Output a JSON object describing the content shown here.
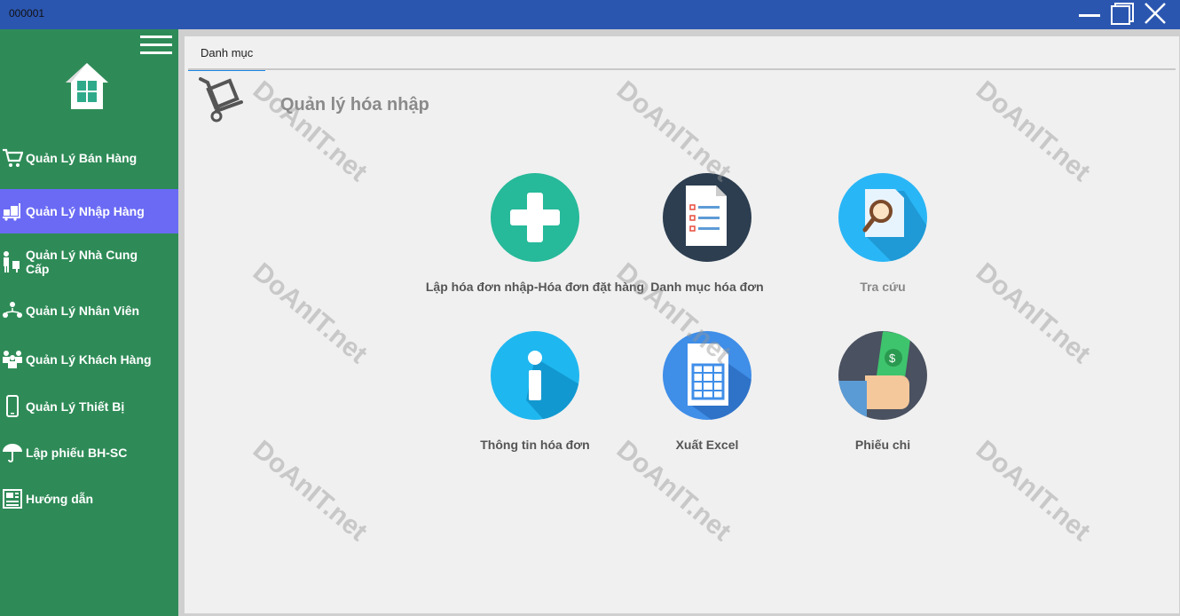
{
  "window": {
    "title": "000001"
  },
  "sidebar": {
    "items": [
      {
        "label": "Quản Lý Bán Hàng",
        "icon": "cart-icon"
      },
      {
        "label": "Quản Lý Nhập Hàng",
        "icon": "trolley-icon"
      },
      {
        "label": "Quản Lý Nhà Cung Cấp",
        "icon": "supplier-icon"
      },
      {
        "label": "Quản Lý Nhân Viên",
        "icon": "staff-icon"
      },
      {
        "label": "Quản Lý Khách Hàng",
        "icon": "customers-icon"
      },
      {
        "label": "Quản Lý Thiết Bị",
        "icon": "phone-icon"
      },
      {
        "label": "Lập phiếu BH-SC",
        "icon": "umbrella-icon"
      },
      {
        "label": "Hướng dẫn",
        "icon": "guide-icon"
      }
    ],
    "active_index": 1
  },
  "main": {
    "tab_label": "Danh mục",
    "title": "Quản lý hóa nhập",
    "tiles": [
      {
        "label": "Lập hóa đơn nhập-Hóa đơn đặt hàng",
        "icon": "plus-icon",
        "color": "#26b99a"
      },
      {
        "label": "Danh mục hóa đơn",
        "icon": "checklist-icon",
        "color": "#2c3e50"
      },
      {
        "label": "Tra cứu",
        "icon": "search-document-icon",
        "color": "#29b6f6"
      },
      {
        "label": "Thông tin hóa đơn",
        "icon": "info-icon",
        "color": "#1fb7f0"
      },
      {
        "label": "Xuất Excel",
        "icon": "spreadsheet-icon",
        "color": "#3f8ee8"
      },
      {
        "label": "Phiếu chi",
        "icon": "cash-hand-icon",
        "color": "#4a5160"
      }
    ]
  },
  "colors": {
    "titlebar": "#2b56b0",
    "sidebar": "#2e8b57",
    "active_item": "#6a6af5",
    "tab_underline": "#1e88e5"
  },
  "watermark": "DoAnIT.net"
}
